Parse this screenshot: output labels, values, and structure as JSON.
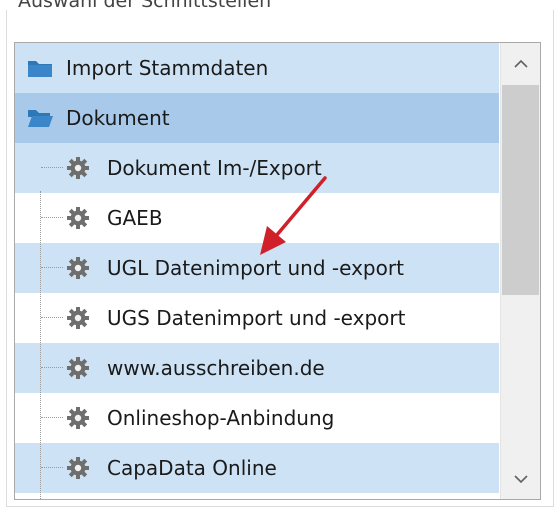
{
  "group_box": {
    "title": "Auswahl der Schnittstellen"
  },
  "tree": {
    "items": [
      {
        "label": "Import Stammdaten",
        "icon": "folder-closed-icon",
        "level": 0
      },
      {
        "label": "Dokument",
        "icon": "folder-open-icon",
        "level": 0,
        "selected": true
      },
      {
        "label": "Dokument Im-/Export",
        "icon": "gear-icon",
        "level": 1
      },
      {
        "label": "GAEB",
        "icon": "gear-icon",
        "level": 1
      },
      {
        "label": "UGL Datenimport und -export",
        "icon": "gear-icon",
        "level": 1
      },
      {
        "label": "UGS Datenimport und -export",
        "icon": "gear-icon",
        "level": 1
      },
      {
        "label": "www.ausschreiben.de",
        "icon": "gear-icon",
        "level": 1
      },
      {
        "label": "Onlineshop-Anbindung",
        "icon": "gear-icon",
        "level": 1
      },
      {
        "label": "CapaData Online",
        "icon": "gear-icon",
        "level": 1
      }
    ]
  },
  "colors": {
    "row_alt": "#cde3f5",
    "row_selected": "#a8c9e9",
    "annotation_arrow": "#d0212a",
    "folder": "#2f78b7"
  }
}
